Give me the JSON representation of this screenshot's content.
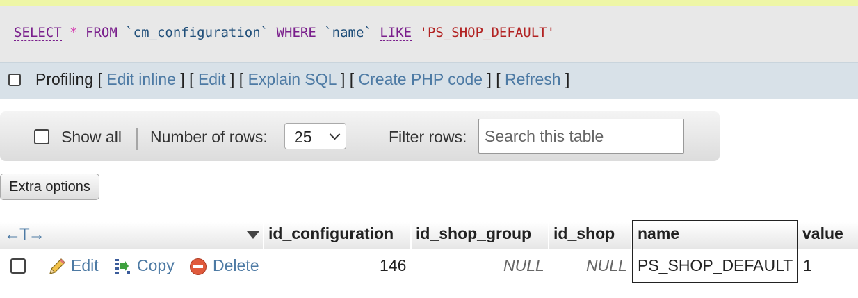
{
  "sql": {
    "select": "SELECT",
    "star": "*",
    "from": "FROM",
    "table": "`cm_configuration`",
    "where": "WHERE",
    "column": "`name`",
    "like": "LIKE",
    "value": "'PS_SHOP_DEFAULT'"
  },
  "profiling": {
    "label": "Profiling",
    "links": [
      "Edit inline",
      "Edit",
      "Explain SQL",
      "Create PHP code",
      "Refresh"
    ]
  },
  "nav": {
    "show_all": "Show all",
    "rows_label": "Number of rows:",
    "rows_value": "25",
    "filter_label": "Filter rows:",
    "filter_placeholder": "Search this table"
  },
  "extra_options": "Extra options",
  "table": {
    "columns": [
      "id_configuration",
      "id_shop_group",
      "id_shop",
      "name",
      "value"
    ],
    "row": {
      "actions": {
        "edit": "Edit",
        "copy": "Copy",
        "delete": "Delete"
      },
      "id_configuration": "146",
      "id_shop_group": "NULL",
      "id_shop": "NULL",
      "name": "PS_SHOP_DEFAULT",
      "value": "1"
    }
  },
  "colors": {
    "link": "#4d7aa4",
    "sql_keyword": "#7a1f8c",
    "sql_string": "#b22222"
  }
}
